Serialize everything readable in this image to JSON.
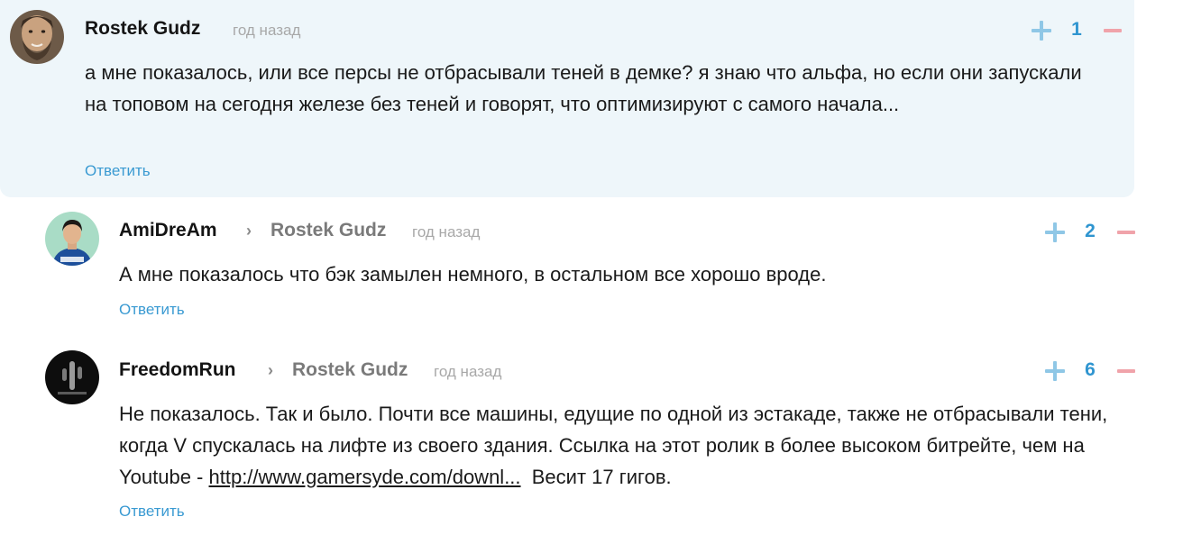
{
  "comments": [
    {
      "author": "Rostek Gudz",
      "reply_to": "",
      "time": "год назад",
      "text": "а мне показалось, или все персы не отбрасывали теней в демке? я знаю что альфа, но если они запускали на топовом на сегодня железе без теней и говорят, что оптимизируют с самого начала...",
      "reply_label": "Ответить",
      "score": "1"
    },
    {
      "author": "AmiDreAm",
      "reply_to": "Rostek Gudz",
      "time": "год назад",
      "text": "А мне показалось что бэк замылен немного, в остальном все хорошо вроде.",
      "reply_label": "Ответить",
      "score": "2"
    },
    {
      "author": "FreedomRun",
      "reply_to": "Rostek Gudz",
      "time": "год назад",
      "text_before": "Не показалось. Так и было. Почти все машины, едущие по одной из эстакаде, также не отбрасывали тени, когда V спускалась на лифте из своего здания. Ссылка на этот ролик в более высоком битрейте, чем на Youtube - ",
      "link": "http://www.gamersyde.com/downl...",
      "text_after": "  Весит 17 гигов.",
      "reply_label": "Ответить",
      "score": "6"
    }
  ],
  "icons": {
    "reply_arrow": "chevron-right-icon",
    "upvote": "plus-icon",
    "downvote": "minus-icon"
  },
  "colors": {
    "highlight_bg": "#eef6fa",
    "accent_blue": "#2f95d0",
    "upvote": "#8fc7e6",
    "downvote": "#f0a3aa"
  }
}
